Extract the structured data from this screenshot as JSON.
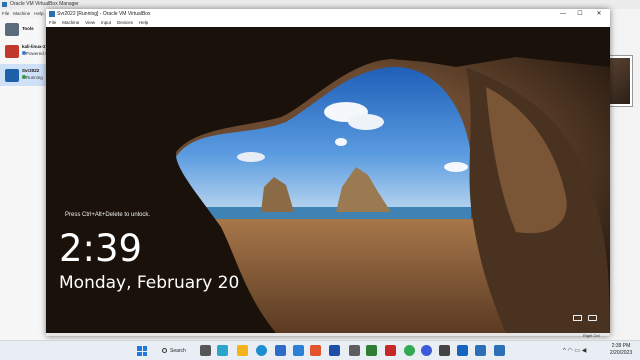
{
  "manager": {
    "title": "Oracle VM VirtualBox Manager",
    "menu": [
      "File",
      "Machine",
      "Help"
    ],
    "tools_label": "Tools",
    "vms": [
      {
        "name": "kali-linux-2",
        "status": "Powered Off",
        "status_color": "#3a7dd8",
        "color": "#c0392b"
      },
      {
        "name": "Svr2022",
        "status": "Running",
        "status_color": "#2e9c3f",
        "color": "#1d5fa8"
      }
    ]
  },
  "vm_window": {
    "title": "Svr2022 [Running] - Oracle VM VirtualBox",
    "controls": {
      "minimize": "—",
      "maximize": "☐",
      "close": "✕"
    },
    "menu": [
      "File",
      "Machine",
      "View",
      "Input",
      "Devices",
      "Help"
    ],
    "status_right": "Right Ctrl"
  },
  "lockscreen": {
    "unlock_hint": "Press Ctrl+Alt+Delete to unlock.",
    "time": "2:39",
    "date": "Monday, February 20",
    "icons": [
      "accessibility-icon",
      "network-icon"
    ]
  },
  "taskbar": {
    "search_label": "Search",
    "apps": [
      "file-explorer-icon",
      "edge-icon",
      "store-icon",
      "mail-icon",
      "settings-icon"
    ],
    "clock_time": "2:39 PM",
    "clock_date": "2/20/2023"
  },
  "colors": {
    "accent": "#1f7adb",
    "taskbar_bg": "#e9eef5",
    "sky": "#3d7fcf"
  }
}
